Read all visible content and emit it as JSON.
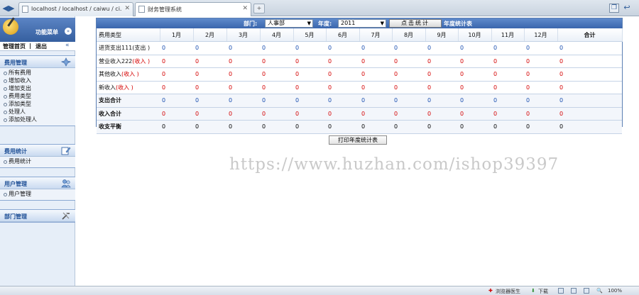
{
  "browser": {
    "tabs": [
      {
        "title": "localhost / localhost / caiwu / ci..."
      },
      {
        "title": "财务管理系统"
      }
    ],
    "new_tab": "+",
    "status": {
      "router": "浏览器医生",
      "download": "下载",
      "zoom": "100%"
    }
  },
  "sidebar": {
    "title": "功能菜单",
    "links": {
      "home": "管理首页",
      "separator": "|",
      "logout": "退出"
    },
    "groups": [
      {
        "title": "费用管理",
        "items": [
          "所有费用",
          "增加收入",
          "增加支出",
          "费用类型",
          "添加类型",
          "处理人",
          "添加处理人"
        ]
      },
      {
        "title": "费用统计",
        "items": [
          "费用统计"
        ]
      },
      {
        "title": "用户管理",
        "items": [
          "用户管理"
        ]
      },
      {
        "title": "部门管理",
        "items": []
      }
    ]
  },
  "filter": {
    "dept_label": "部门:",
    "dept_value": "人事部",
    "year_label": "年度:",
    "year_value": "2011",
    "button": "点击统计",
    "caption": "年度统计表"
  },
  "table": {
    "header": [
      "费用类型",
      "1月",
      "2月",
      "3月",
      "4月",
      "5月",
      "6月",
      "7月",
      "8月",
      "9月",
      "10月",
      "11月",
      "12月",
      "合计"
    ],
    "rows": [
      {
        "name": "进货支出111",
        "tag": "(支出 )",
        "tag_type": "expense",
        "values": [
          "0",
          "0",
          "0",
          "0",
          "0",
          "0",
          "0",
          "0",
          "0",
          "0",
          "0",
          "0",
          "0"
        ],
        "tone": "blue"
      },
      {
        "name": "营业收入222",
        "tag": "(收入 )",
        "tag_type": "income",
        "values": [
          "0",
          "0",
          "0",
          "0",
          "0",
          "0",
          "0",
          "0",
          "0",
          "0",
          "0",
          "0",
          "0"
        ],
        "tone": "red"
      },
      {
        "name": "其他收入",
        "tag": "(收入 )",
        "tag_type": "income",
        "values": [
          "0",
          "0",
          "0",
          "0",
          "0",
          "0",
          "0",
          "0",
          "0",
          "0",
          "0",
          "0",
          "0"
        ],
        "tone": "red"
      },
      {
        "name": "新收入",
        "tag": "(收入 )",
        "tag_type": "income",
        "values": [
          "0",
          "0",
          "0",
          "0",
          "0",
          "0",
          "0",
          "0",
          "0",
          "0",
          "0",
          "0",
          "0"
        ],
        "tone": "red"
      },
      {
        "name": "支出合计",
        "tag": "",
        "tag_type": "total",
        "values": [
          "0",
          "0",
          "0",
          "0",
          "0",
          "0",
          "0",
          "0",
          "0",
          "0",
          "0",
          "0",
          "0"
        ],
        "tone": "blue"
      },
      {
        "name": "收入合计",
        "tag": "",
        "tag_type": "total",
        "values": [
          "0",
          "0",
          "0",
          "0",
          "0",
          "0",
          "0",
          "0",
          "0",
          "0",
          "0",
          "0",
          "0"
        ],
        "tone": "red"
      },
      {
        "name": "收支平衡",
        "tag": "",
        "tag_type": "total",
        "values": [
          "0",
          "0",
          "0",
          "0",
          "0",
          "0",
          "0",
          "0",
          "0",
          "0",
          "0",
          "0",
          "0"
        ],
        "tone": "black"
      }
    ]
  },
  "print_button": "打印年度统计表",
  "watermark": "https://www.huzhan.com/ishop39397"
}
